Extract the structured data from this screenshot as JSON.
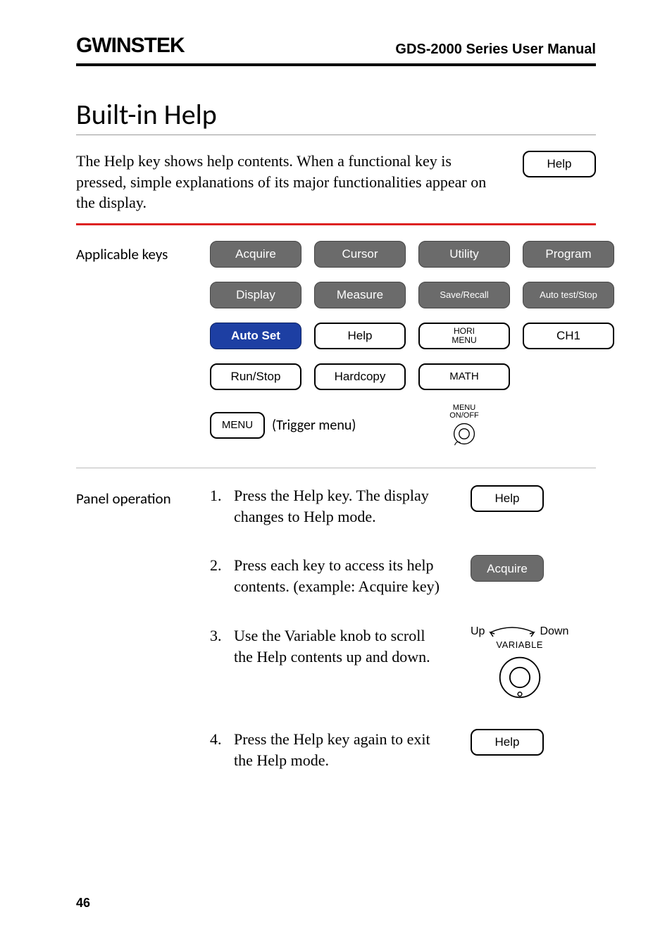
{
  "header": {
    "logo": "GWINSTEK",
    "manual": "GDS-2000 Series User Manual"
  },
  "title": "Built-in Help",
  "intro": "The Help key shows help contents. When a functional key is pressed, simple explanations of its major functionalities appear on the display.",
  "intro_key": "Help",
  "applicable": {
    "label": "Applicable keys",
    "keys": {
      "acquire": "Acquire",
      "cursor": "Cursor",
      "utility": "Utility",
      "program": "Program",
      "display": "Display",
      "measure": "Measure",
      "save_recall": "Save/Recall",
      "auto_test": "Auto test/Stop",
      "auto_set": "Auto Set",
      "help": "Help",
      "hori_menu_l1": "HORI",
      "hori_menu_l2": "MENU",
      "ch1": "CH1",
      "run_stop": "Run/Stop",
      "hardcopy": "Hardcopy",
      "math": "MATH",
      "menu": "MENU",
      "trigger_label": "(Trigger menu)",
      "menu_onoff_l1": "MENU",
      "menu_onoff_l2": "ON/OFF"
    }
  },
  "panel": {
    "label": "Panel operation",
    "steps": [
      {
        "n": "1.",
        "text": "Press the Help key. The display changes to Help mode.",
        "key": "Help",
        "key_style": "outline"
      },
      {
        "n": "2.",
        "text": "Press each key  to access its help contents. (example: Acquire key)",
        "key": "Acquire",
        "key_style": "dark"
      },
      {
        "n": "3.",
        "text": "Use the Variable knob to scroll the Help contents up and down.",
        "variable": true,
        "up": "Up",
        "down": "Down",
        "var": "VARIABLE"
      },
      {
        "n": "4.",
        "text": "Press the Help key again to exit the Help mode.",
        "key": "Help",
        "key_style": "outline"
      }
    ]
  },
  "page": "46"
}
